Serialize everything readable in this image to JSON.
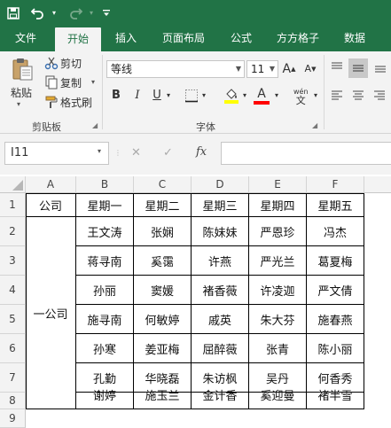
{
  "quick_access": {
    "save_icon": "save-icon",
    "undo_icon": "undo-icon",
    "redo_icon": "redo-icon",
    "customize_icon": "customize-icon"
  },
  "tabs": [
    "文件",
    "开始",
    "插入",
    "页面布局",
    "公式",
    "方方格子",
    "数据"
  ],
  "active_tab": "开始",
  "clipboard": {
    "paste": "粘贴",
    "cut": "剪切",
    "copy": "复制",
    "format_painter": "格式刷",
    "group_label": "剪贴板"
  },
  "font": {
    "name": "等线",
    "size": "11",
    "bold": "B",
    "italic": "I",
    "underline": "U",
    "font_color_letter": "A",
    "grow": "A",
    "shrink": "A",
    "wen": "wén",
    "wen_sub": "文",
    "group_label": "字体"
  },
  "colors": {
    "ribbon_green": "#217346",
    "fill_yellow": "#ffff00",
    "font_red": "#ff0000"
  },
  "formula_bar": {
    "name_box": "I11",
    "cancel": "✕",
    "confirm": "✓",
    "fx": "fx",
    "value": ""
  },
  "sheet": {
    "columns": [
      "A",
      "B",
      "C",
      "D",
      "E",
      "F"
    ],
    "rows": [
      "1",
      "2",
      "3",
      "4",
      "5",
      "6",
      "7",
      "8",
      "9"
    ],
    "a1": "公司",
    "headers": [
      "星期一",
      "星期二",
      "星期三",
      "星期四",
      "星期五"
    ],
    "merged_a": "一公司",
    "data": [
      [
        "王文涛",
        "张娴",
        "陈妹妹",
        "严恩珍",
        "冯杰"
      ],
      [
        "蒋寻南",
        "奚霭",
        "许燕",
        "严光兰",
        "葛夏梅"
      ],
      [
        "孙丽",
        "窦媛",
        "褚香薇",
        "许凌迦",
        "严文倩"
      ],
      [
        "施寻南",
        "何敏婷",
        "戚英",
        "朱大芬",
        "施春燕"
      ],
      [
        "孙寒",
        "姜亚梅",
        "屈醉薇",
        "张青",
        "陈小丽"
      ],
      [
        "孔勤",
        "华晓磊",
        "朱访枫",
        "吴丹",
        "何香秀"
      ],
      [
        "谢婷",
        "施玉兰",
        "金计香",
        "奚迎曼",
        "褚半雪"
      ]
    ]
  }
}
